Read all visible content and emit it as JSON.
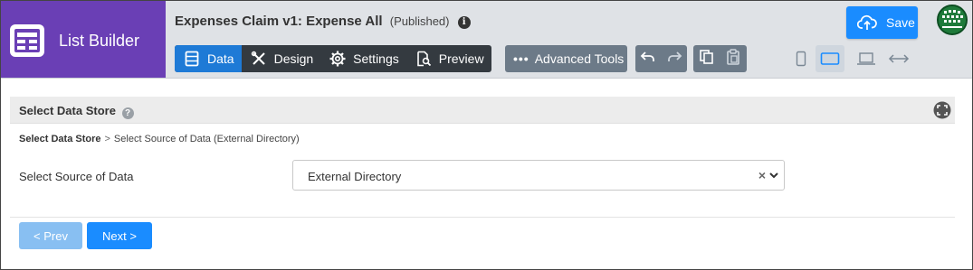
{
  "app": {
    "name": "List Builder"
  },
  "form": {
    "title": "Expenses Claim v1: Expense All",
    "status": "(Published)"
  },
  "toolbar": {
    "tabs": [
      {
        "label": "Data",
        "icon": "table-icon",
        "active": true
      },
      {
        "label": "Design",
        "icon": "pencil-ruler-icon",
        "active": false
      },
      {
        "label": "Settings",
        "icon": "gear-icon",
        "active": false
      },
      {
        "label": "Preview",
        "icon": "document-search-icon",
        "active": false
      }
    ],
    "advanced_label": "Advanced Tools",
    "save_label": "Save"
  },
  "section": {
    "title": "Select Data Store"
  },
  "breadcrumb": {
    "root": "Select Data Store",
    "separator": ">",
    "current": "Select Source of Data (External Directory)"
  },
  "source_field": {
    "label": "Select Source of Data",
    "value": "External Directory",
    "clear": "×"
  },
  "nav": {
    "prev_label": "< Prev",
    "next_label": "Next >"
  },
  "colors": {
    "brand": "#6a3fb5",
    "primary": "#1a8cff",
    "tab_bg": "#343a40",
    "tool_bg": "#6c7a88",
    "disabled_primary": "#88bff2"
  }
}
